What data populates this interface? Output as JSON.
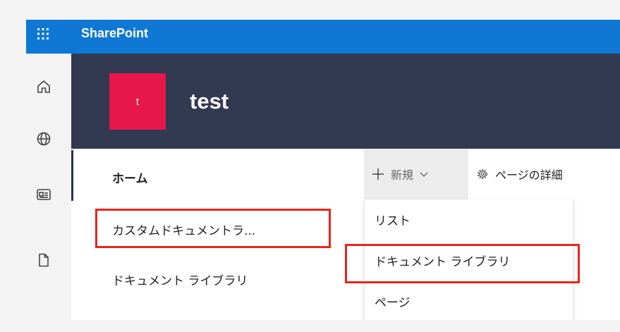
{
  "suite_bar": {
    "brand": "SharePoint",
    "color": "#0f78d4"
  },
  "left_rail": {
    "icons": [
      "home-icon",
      "globe-icon",
      "news-icon",
      "file-icon"
    ]
  },
  "site": {
    "logo_letter": "t",
    "logo_color": "#e8174b",
    "title": "test",
    "header_color": "#323a52"
  },
  "site_nav": {
    "items": [
      {
        "label": "ホーム",
        "selected": true
      },
      {
        "label": "カスタムドキュメントラ...",
        "highlighted": true
      },
      {
        "label": "ドキュメント ライブラリ"
      }
    ]
  },
  "command_bar": {
    "new_label": "新規",
    "page_details_label": "ページの詳細"
  },
  "new_menu": {
    "items": [
      {
        "label": "リスト"
      },
      {
        "label": "ドキュメント ライブラリ",
        "highlighted": true
      },
      {
        "label": "ページ"
      }
    ]
  },
  "highlight_color": "#e8261d"
}
